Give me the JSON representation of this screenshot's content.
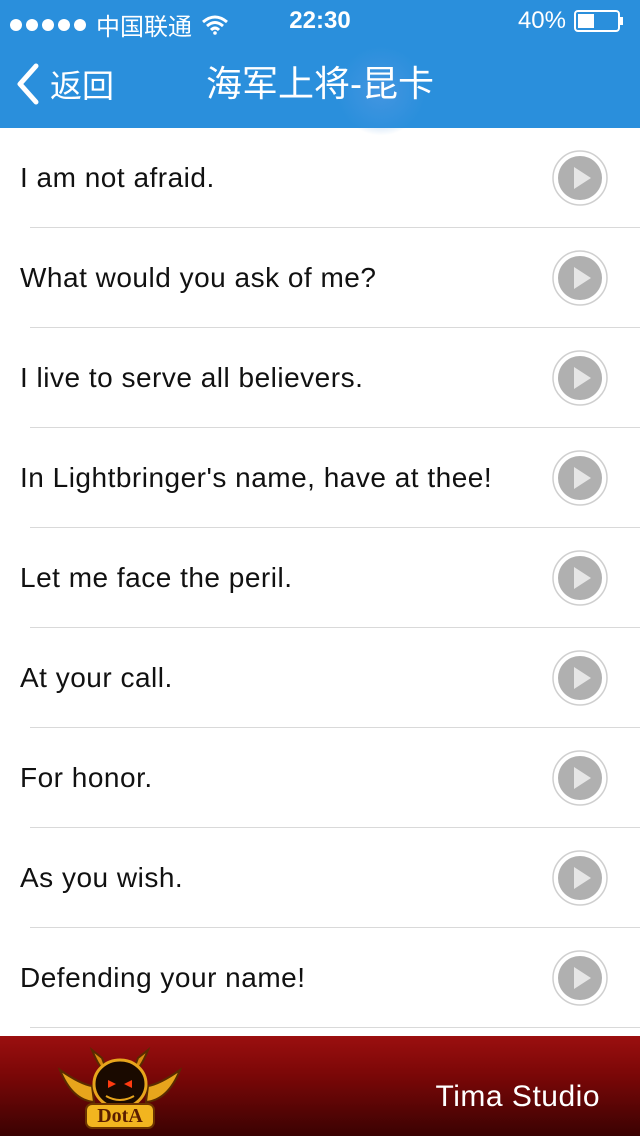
{
  "status_bar": {
    "carrier": "中国联通",
    "time": "22:30",
    "battery": "40%"
  },
  "nav": {
    "back_label": "返回",
    "title": "海军上将-昆卡"
  },
  "quotes": [
    {
      "text": "I am not afraid."
    },
    {
      "text": "What would you ask of me?"
    },
    {
      "text": "I live to serve all believers."
    },
    {
      "text": "In Lightbringer's name, have at thee!"
    },
    {
      "text": "Let me face the peril."
    },
    {
      "text": "At your call."
    },
    {
      "text": "For honor."
    },
    {
      "text": "As you wish."
    },
    {
      "text": "Defending your name!"
    }
  ],
  "footer": {
    "logo_text": "DotA",
    "studio": "Tima Studio"
  },
  "colors": {
    "header": "#2a8fdc",
    "footer": "#7a0707",
    "separator": "#d9d9d9"
  }
}
